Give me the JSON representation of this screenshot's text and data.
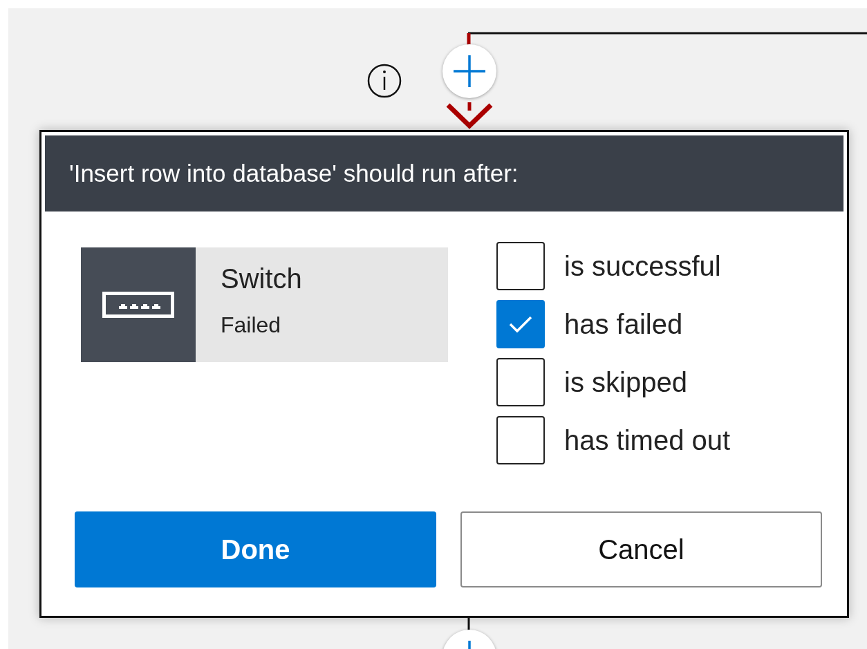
{
  "dialog": {
    "title": "'Insert row into database' should run after:",
    "action": {
      "name": "Switch",
      "status": "Failed"
    },
    "conditions": [
      {
        "label": "is successful",
        "checked": false
      },
      {
        "label": "has failed",
        "checked": true
      },
      {
        "label": "is skipped",
        "checked": false
      },
      {
        "label": "has timed out",
        "checked": false
      }
    ],
    "buttons": [
      {
        "label": "Done",
        "kind": "primary"
      },
      {
        "label": "Cancel",
        "kind": "secondary"
      }
    ]
  }
}
